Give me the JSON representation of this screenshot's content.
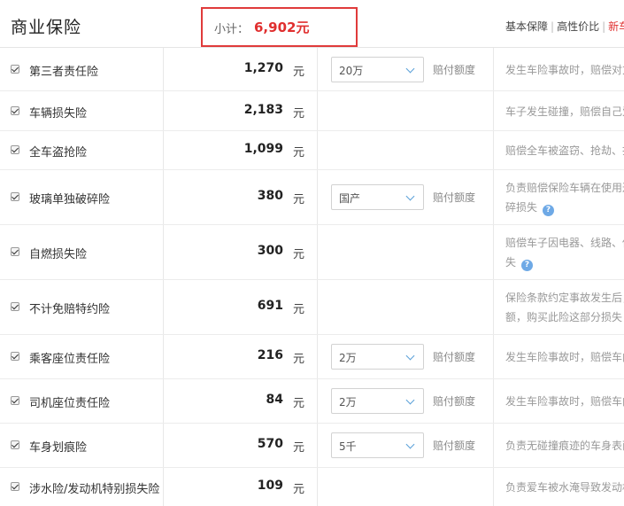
{
  "header": {
    "title": "商业保险",
    "subtotal_label": "小计：",
    "subtotal_value": "6,902元",
    "tabs": [
      "基本保障",
      "高性价比",
      "新车"
    ]
  },
  "rows": [
    {
      "name": "第三者责任险",
      "price": "1,270",
      "unit": "元",
      "select": "20万",
      "coverage_label": "赔付额度",
      "desc": [
        "发生车险事故时，赔偿对方"
      ],
      "help": false
    },
    {
      "name": "车辆损失险",
      "price": "2,183",
      "unit": "元",
      "select": null,
      "coverage_label": null,
      "desc": [
        "车子发生碰撞，赔偿自己爱车"
      ],
      "help": false
    },
    {
      "name": "全车盗抢险",
      "price": "1,099",
      "unit": "元",
      "select": null,
      "coverage_label": null,
      "desc": [
        "赔偿全车被盗窃、抢劫、抢夺"
      ],
      "help": false
    },
    {
      "name": "玻璃单独破碎险",
      "price": "380",
      "unit": "元",
      "select": "国产",
      "coverage_label": "赔付额度",
      "desc": [
        "负责赔偿保险车辆在使用过程",
        "碎损失"
      ],
      "help": true
    },
    {
      "name": "自燃损失险",
      "price": "300",
      "unit": "元",
      "select": null,
      "coverage_label": null,
      "desc": [
        "赔偿车子因电器、线路、供油",
        "失"
      ],
      "help": true
    },
    {
      "name": "不计免赔特约险",
      "price": "691",
      "unit": "元",
      "select": null,
      "coverage_label": null,
      "desc": [
        "保险条款约定事故发生后，",
        "额，购买此险这部分损失"
      ],
      "help": false
    },
    {
      "name": "乘客座位责任险",
      "price": "216",
      "unit": "元",
      "select": "2万",
      "coverage_label": "赔付额度",
      "desc": [
        "发生车险事故时，赔偿车内乘客"
      ],
      "help": false
    },
    {
      "name": "司机座位责任险",
      "price": "84",
      "unit": "元",
      "select": "2万",
      "coverage_label": "赔付额度",
      "desc": [
        "发生车险事故时，赔偿车内司机"
      ],
      "help": false
    },
    {
      "name": "车身划痕险",
      "price": "570",
      "unit": "元",
      "select": "5千",
      "coverage_label": "赔付额度",
      "desc": [
        "负责无碰撞痕迹的车身表面"
      ],
      "help": false
    },
    {
      "name": "涉水险/发动机特别损失险",
      "price": "109",
      "unit": "元",
      "select": null,
      "coverage_label": null,
      "desc": [
        "负责爱车被水淹导致发动机"
      ],
      "help": false
    }
  ]
}
